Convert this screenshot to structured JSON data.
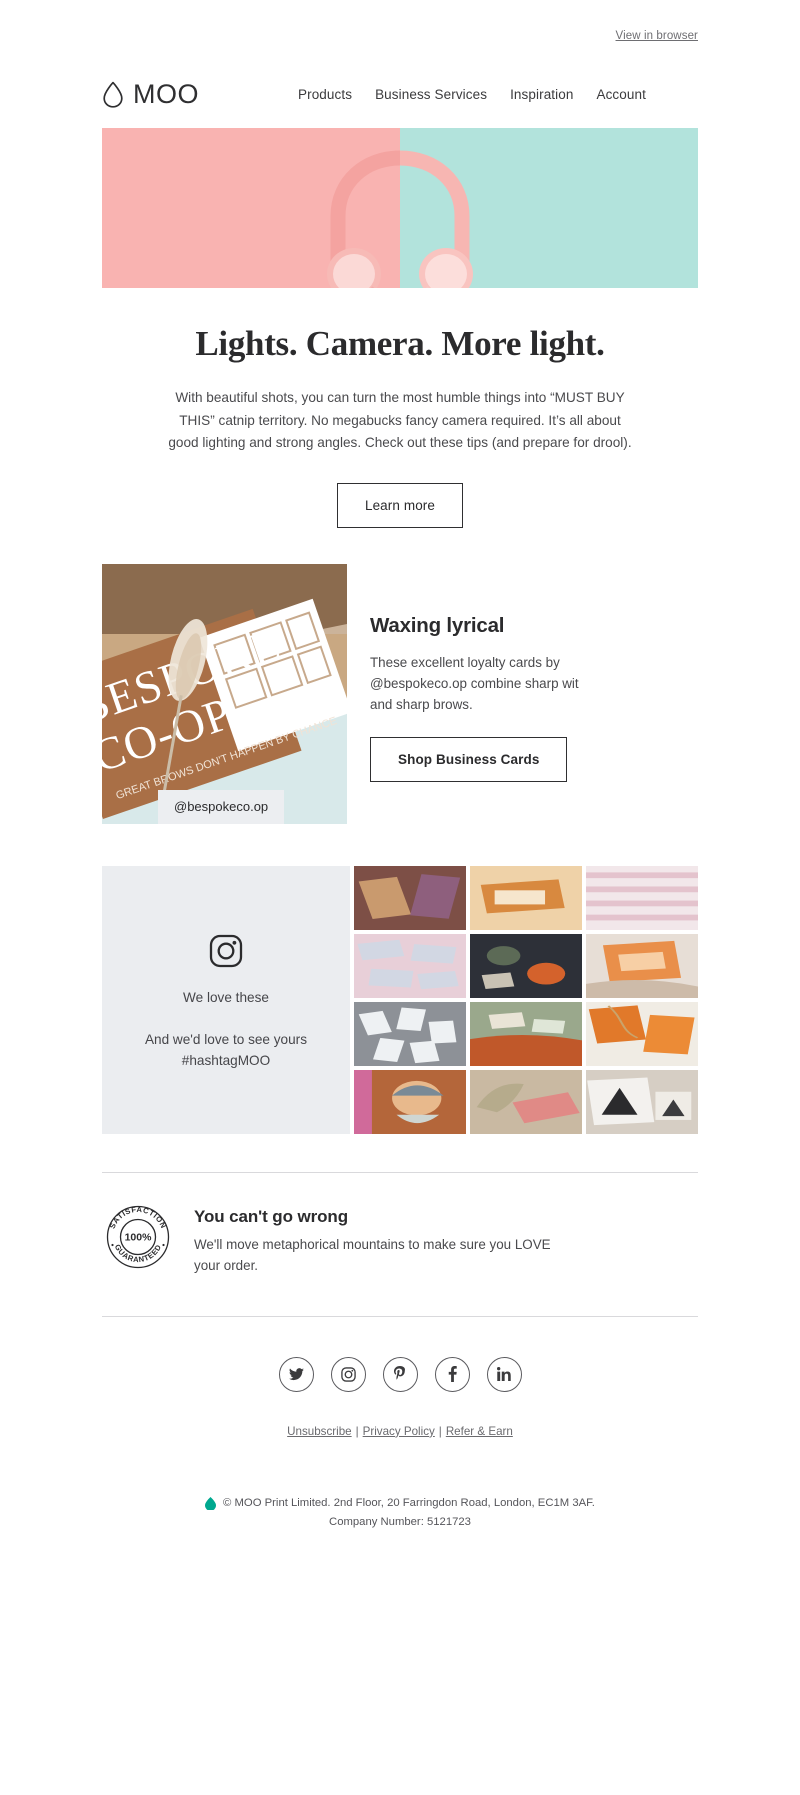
{
  "preheader": {
    "view_in_browser": "View in browser"
  },
  "nav": {
    "brand": "MOO",
    "brand_icon": "water-drop-icon",
    "links": [
      {
        "label": "Products"
      },
      {
        "label": "Business Services"
      },
      {
        "label": "Inspiration"
      },
      {
        "label": "Account"
      }
    ]
  },
  "hero": {
    "image_alt": "pink headphones on split pink and mint background",
    "left_color": "#f9b3b1",
    "right_color": "#b2e3dc"
  },
  "main": {
    "headline": "Lights. Camera. More light.",
    "lede": "With beautiful shots, you can turn the most humble things into “MUST BUY THIS” catnip territory. No megabucks fancy camera required. It’s all about good lighting and strong angles. Check out these tips (and prepare for drool).",
    "cta_label": "Learn more"
  },
  "feature": {
    "image_alt": "Bespoke Co-op brown loyalty cards with dried pampas grass",
    "caption": "@bespokeco.op",
    "title": "Waxing lyrical",
    "body": "These excellent loyalty cards by @bespokeco.op combine sharp wit and sharp brows.",
    "cta_label": "Shop Business Cards"
  },
  "instagram": {
    "icon": "instagram-icon",
    "line1": "We love these",
    "line2": "And we'd love to see yours #hashtagMOO",
    "tiles": [
      {
        "alt": "colourful patterned cards",
        "c1": "#7d4f46",
        "c2": "#c99a6e"
      },
      {
        "alt": "orange and cream business cards on wood",
        "c1": "#d8893f",
        "c2": "#efd2a8"
      },
      {
        "alt": "pink and white striped cards",
        "c1": "#e4c3cd",
        "c2": "#f2e7ea"
      },
      {
        "alt": "pastel marbled cards spread out",
        "c1": "#e8cfd8",
        "c2": "#cfd9e6"
      },
      {
        "alt": "dark flatlay with green and orange stickers",
        "c1": "#2d3038",
        "c2": "#5c6a56"
      },
      {
        "alt": "hand holding orange patterned card",
        "c1": "#e2enger",
        "c2": "#e98f4a"
      },
      {
        "alt": "white cards scattered on dark surface",
        "c1": "#cfd2d6",
        "c2": "#8d9197"
      },
      {
        "alt": "sage green and rust fabric with tags",
        "c1": "#9aa88c",
        "c2": "#c0582a"
      },
      {
        "alt": "orange gift tags with string",
        "c1": "#e1792a",
        "c2": "#f0b36b"
      },
      {
        "alt": "painted portrait postcard",
        "c1": "#b4663a",
        "c2": "#d9a06a"
      },
      {
        "alt": "pink card with gold foil and dried palm",
        "c1": "#d8a29a",
        "c2": "#c9b9a2"
      },
      {
        "alt": "black and white cat illustration cards",
        "c1": "#d6cec4",
        "c2": "#8f877d"
      }
    ]
  },
  "guarantee": {
    "badge_icon": "satisfaction-guaranteed-stamp-icon",
    "badge_top_text": "SATISFACTION",
    "badge_center_text": "100%",
    "badge_bottom_text": "GUARANTEED",
    "title": "You can't go wrong",
    "body": "We'll move metaphorical mountains to make sure you LOVE your order."
  },
  "footer": {
    "socials": [
      {
        "name": "twitter-icon",
        "label": "Twitter"
      },
      {
        "name": "instagram-icon",
        "label": "Instagram"
      },
      {
        "name": "pinterest-icon",
        "label": "Pinterest"
      },
      {
        "name": "facebook-icon",
        "label": "Facebook"
      },
      {
        "name": "linkedin-icon",
        "label": "LinkedIn"
      }
    ],
    "links": [
      {
        "label": "Unsubscribe"
      },
      {
        "label": "Privacy Policy"
      },
      {
        "label": "Refer & Earn"
      }
    ],
    "separator": "|",
    "copyright_line1": "© MOO Print Limited. 2nd Floor, 20 Farringdon Road, London, EC1M 3AF.",
    "copyright_line2": "Company Number: 5121723",
    "drop_color": "#00a88f"
  }
}
